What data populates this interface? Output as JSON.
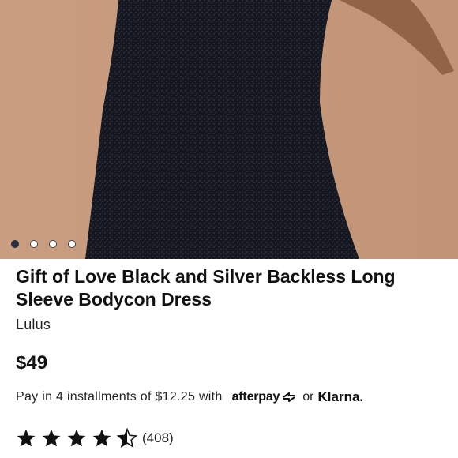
{
  "product": {
    "title": "Gift of Love Black and Silver Backless Long Sleeve Bodycon Dress",
    "brand": "Lulus",
    "price": "$49"
  },
  "carousel": {
    "slide_count": 4,
    "active_index": 0
  },
  "payment": {
    "installment_text": "Pay in 4 installments of $12.25 with",
    "afterpay_label": "afterpay",
    "or_text": "or",
    "klarna_label": "Klarna."
  },
  "reviews": {
    "rating": 4.5,
    "max_rating": 5,
    "count_label": "(408)"
  },
  "colors": {
    "hero_background": "#c69a7c",
    "dress": "#1c1f2b",
    "active_dot": "#2b3140"
  }
}
